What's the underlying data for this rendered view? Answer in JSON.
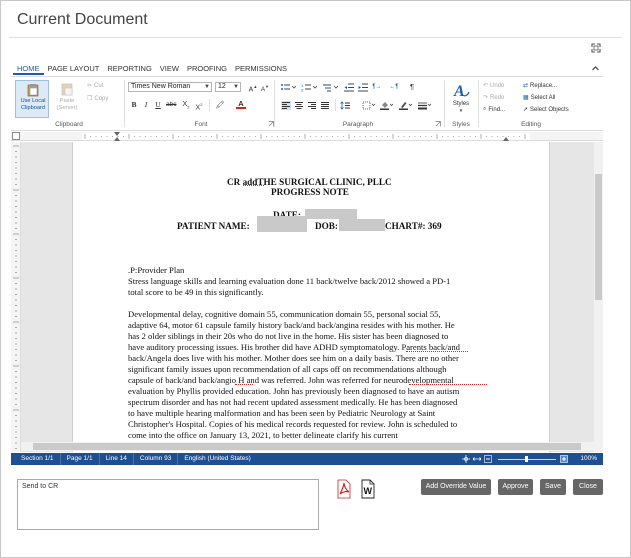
{
  "window": {
    "title": "Current Document"
  },
  "ribbon": {
    "tabs": [
      {
        "label": "HOME"
      },
      {
        "label": "PAGE LAYOUT"
      },
      {
        "label": "REPORTING"
      },
      {
        "label": "VIEW"
      },
      {
        "label": "PROOFING"
      },
      {
        "label": "PERMISSIONS"
      }
    ],
    "clipboard": {
      "use_local": "Use Local Clipboard",
      "paste": "Paste",
      "paste_sub": "(Server)",
      "cut": "Cut",
      "copy": "Copy",
      "label": "Clipboard"
    },
    "font": {
      "family": "Times New Roman",
      "size": "12",
      "label": "Font"
    },
    "paragraph": {
      "label": "Paragraph"
    },
    "styles": {
      "button": "Styles",
      "label": "Styles"
    },
    "editing": {
      "undo": "Undo",
      "redo": "Redo",
      "find": "Find...",
      "replace": "Replace...",
      "select_all": "Select All",
      "select_objects": "Select Objects",
      "label": "Editing"
    }
  },
  "document": {
    "heading1": "CR addTHE SURGICAL CLINIC, PLLC",
    "heading2": "PROGRESS NOTE",
    "date_label": "DATE:",
    "patient_label": "PATIENT NAME:",
    "dob_label": "DOB:",
    "chart_label": "CHART#: 369",
    "section": ".P:Provider Plan",
    "p1": [
      "Stress language skills and learning evaluation done 11 back/twelve back/2012 showed a PD-1",
      "total score to be 49 in this significantly."
    ],
    "p2": [
      "Developmental delay, cognitive domain 55, communication domain 55, personal social 55,",
      "adaptive 64, motor 61 capsule family history back/and back/angina resides with his mother. He",
      "has 2 older siblings in their 20s who do not live in the home. His sister has been diagnosed to",
      "have auditory processing issues. His brother did have ADHD symptomatology. Parents back/and",
      "back/Angela does live with his mother. Mother does see him on a daily basis. There are no other",
      "significant family issues upon recommendation of all caps off on recommendations although",
      "capsule of back/and back/angio H and was referred. John was referred for neurodevelopmental",
      "evaluation by Phyllis provided education. John has previously been diagnosed to have an autism",
      "spectrum disorder and has not had recent updated assessment medically. He has been diagnosed",
      "to have multiple hearing malformation and has been seen by Pediatric Neurology at Saint",
      "Christopher's Hospital. Copies of his medical records requested for review. John is scheduled to",
      "come into the office on January 13, 2021, to better delineate clarify his current"
    ]
  },
  "status": {
    "section": "Section 1/1",
    "page": "Page 1/1",
    "line": "Line 14",
    "column": "Column 93",
    "language": "English (United States)",
    "zoom": "100%"
  },
  "footer": {
    "comment": "Send to CR",
    "add_override": "Add Override Value",
    "approve": "Approve",
    "save": "Save",
    "close": "Close"
  },
  "colors": {
    "accent": "#1a5fa8",
    "statusbar": "#1e4f91",
    "button": "#666666"
  }
}
